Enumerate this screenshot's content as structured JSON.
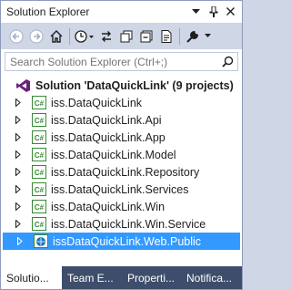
{
  "window": {
    "title": "Solution Explorer",
    "dropdown_glyph": "▾",
    "pin_glyph": "📌",
    "close_glyph": "✕"
  },
  "toolbar": {
    "icons": [
      "back-icon",
      "forward-icon",
      "home-icon",
      "history-clock-icon",
      "sync-icon",
      "pending-changes-icon",
      "collapse-all-icon",
      "show-all-files-icon",
      "properties-wrench-icon"
    ],
    "dropdown_glyph": "▾"
  },
  "search": {
    "placeholder": "Search Solution Explorer (Ctrl+;)",
    "value": ""
  },
  "tree": {
    "solution": {
      "label": "Solution 'DataQuickLink' (9 projects)"
    },
    "projects": [
      {
        "label": "iss.DataQuickLink",
        "selected": false
      },
      {
        "label": "iss.DataQuickLink.Api",
        "selected": false
      },
      {
        "label": "iss.DataQuickLink.App",
        "selected": false
      },
      {
        "label": "iss.DataQuickLink.Model",
        "selected": false
      },
      {
        "label": "iss.DataQuickLink.Repository",
        "selected": false
      },
      {
        "label": "iss.DataQuickLink.Services",
        "selected": false
      },
      {
        "label": "iss.DataQuickLink.Win",
        "selected": false
      },
      {
        "label": "iss.DataQuickLink.Win.Service",
        "selected": false
      },
      {
        "label": "issDataQuickLink.Web.Public",
        "selected": true
      }
    ]
  },
  "tabs": [
    {
      "label": "Solutio...",
      "active": true
    },
    {
      "label": "Team E...",
      "active": false
    },
    {
      "label": "Properti...",
      "active": false
    },
    {
      "label": "Notifica...",
      "active": false
    }
  ],
  "colors": {
    "selection": "#3399ff",
    "toolbar_bg": "#cfd6e5",
    "tab_bar_bg": "#3e4d6b",
    "vs_purple": "#68217a",
    "cs_green": "#388a34"
  }
}
